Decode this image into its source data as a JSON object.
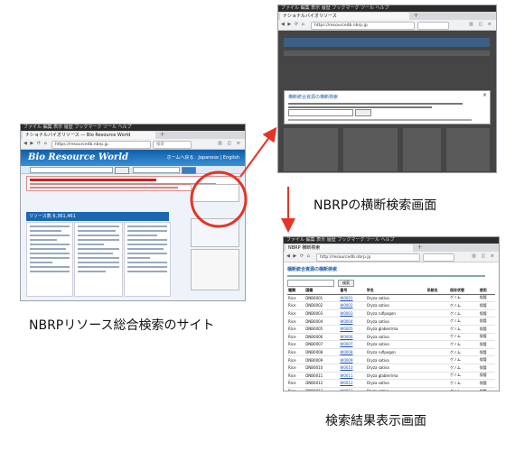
{
  "captions": {
    "left": "NBRPリソース総合検索のサイト",
    "right_top": "NBRPの横断検索画面",
    "right_bottom": "検索結果表示画面"
  },
  "colors": {
    "highlight": "#e63327",
    "arrow": "#e63327"
  },
  "screenshot_left": {
    "tab_title": "ナショナルバイオリソース — Bio Resource World",
    "url": "https://resourcedb.nbrp.jp",
    "search_placeholder": "検索",
    "site_logo": "Bio Resource World",
    "lang_links": "ホームへ戻る　Japanese | English",
    "section_header": "リソース数  6,361,461",
    "highlight_label": "NBRPの横断検索"
  },
  "screenshot_right_top": {
    "tab_title": "ナショナルバイオリソース",
    "url": "https://resourcedb.nbrp.jp",
    "modal_title": "横断統合資源の横断検索"
  },
  "screenshot_right_bottom": {
    "tab_title": "NBRP 横断検索",
    "url": "http://resourcedb.nbrp.jp",
    "results_title": "横断統合資源の横断検索",
    "search_button": "検索",
    "columns": [
      "種類",
      "国籍",
      "番号",
      "学名",
      "系統名",
      "保存状態",
      "使用"
    ],
    "rows": [
      [
        "Rice",
        "DNB0001",
        "W0001",
        "Oryza sativa",
        "",
        "ゲノム",
        "保管"
      ],
      [
        "Rice",
        "DNB0002",
        "W0002",
        "Oryza sativa",
        "",
        "ゲノム",
        "保管"
      ],
      [
        "Rice",
        "DNB0003",
        "W0003",
        "Oryza rufipogon",
        "",
        "ゲノム",
        "保管"
      ],
      [
        "Rice",
        "DNB0004",
        "W0004",
        "Oryza sativa",
        "",
        "ゲノム",
        "保管"
      ],
      [
        "Rice",
        "DNB0005",
        "W0005",
        "Oryza glaberrima",
        "",
        "ゲノム",
        "保管"
      ],
      [
        "Rice",
        "DNB0006",
        "W0006",
        "Oryza sativa",
        "",
        "ゲノム",
        "保管"
      ],
      [
        "Rice",
        "DNB0007",
        "W0007",
        "Oryza sativa",
        "",
        "ゲノム",
        "保管"
      ],
      [
        "Rice",
        "DNB0008",
        "W0008",
        "Oryza rufipogon",
        "",
        "ゲノム",
        "保管"
      ],
      [
        "Rice",
        "DNB0009",
        "W0009",
        "Oryza sativa",
        "",
        "ゲノム",
        "保管"
      ],
      [
        "Rice",
        "DNB0010",
        "W0010",
        "Oryza sativa",
        "",
        "ゲノム",
        "保管"
      ],
      [
        "Rice",
        "DNB0011",
        "W0011",
        "Oryza glaberrima",
        "",
        "ゲノム",
        "保管"
      ],
      [
        "Rice",
        "DNB0012",
        "W0012",
        "Oryza sativa",
        "",
        "ゲノム",
        "保管"
      ],
      [
        "Rice",
        "DNB0013",
        "W0013",
        "Oryza sativa",
        "",
        "ゲノム",
        "保管"
      ],
      [
        "Rice",
        "DNB0014",
        "W0014",
        "Oryza rufipogon",
        "",
        "ゲノム",
        "保管"
      ],
      [
        "Rice",
        "DNB0015",
        "W0015",
        "Oryza sativa",
        "",
        "ゲノム",
        "保管"
      ],
      [
        "Rice",
        "DNB0016",
        "W0016",
        "Oryza sativa",
        "",
        "ゲノム",
        "保管"
      ],
      [
        "Rice",
        "DNB0017",
        "W0017",
        "Oryza sativa",
        "",
        "ゲノム",
        "保管"
      ],
      [
        "Rice",
        "DNB0018",
        "W0018",
        "Oryza glaberrima",
        "",
        "ゲノム",
        "保管"
      ],
      [
        "Rice",
        "DNB0019",
        "W0019",
        "Oryza sativa",
        "",
        "ゲノム",
        "保管"
      ],
      [
        "Rice",
        "DNB0020",
        "W0020",
        "Oryza sativa",
        "",
        "ゲノム",
        "保管"
      ],
      [
        "Rice",
        "DNB0021",
        "W0021",
        "Oryza sativa",
        "",
        "ゲノム",
        "保管"
      ]
    ]
  }
}
